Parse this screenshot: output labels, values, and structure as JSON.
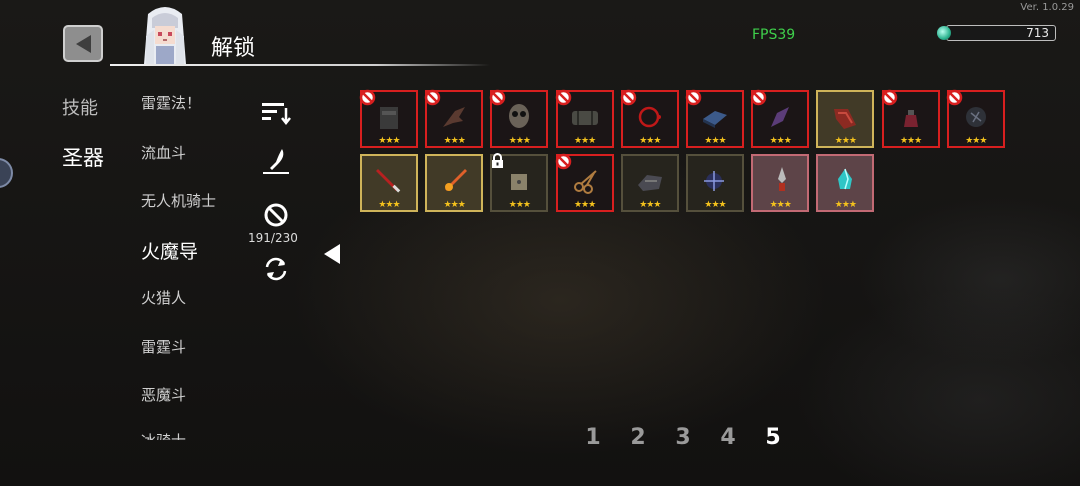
{
  "version": "Ver. 1.0.29",
  "fps": "FPS39",
  "gems": "713",
  "title": "解锁",
  "categories": [
    {
      "label": "技能",
      "active": false
    },
    {
      "label": "圣器",
      "active": true
    }
  ],
  "characters": [
    "雷霆法！",
    "流血斗",
    "无人机骑士",
    "火魔导",
    "火猎人",
    "雷霆斗",
    "恶魔斗",
    "冰骑士"
  ],
  "active_character": "火魔导",
  "tools": [
    "sort-icon",
    "quill-icon",
    "ban-icon",
    "refresh-icon"
  ],
  "unlock_count": "191/230",
  "slots": [
    {
      "item": "black-armor-icon",
      "frame": "red",
      "banned": true,
      "locked": false,
      "stars": "★★★"
    },
    {
      "item": "dark-claw-icon",
      "frame": "red",
      "banned": true,
      "locked": false,
      "stars": "★★★"
    },
    {
      "item": "skull-mask-icon",
      "frame": "red",
      "banned": true,
      "locked": false,
      "stars": "★★★"
    },
    {
      "item": "barrel-icon",
      "frame": "red",
      "banned": true,
      "locked": false,
      "stars": "★★★"
    },
    {
      "item": "red-ring-icon",
      "frame": "red",
      "banned": true,
      "locked": false,
      "stars": "★★★"
    },
    {
      "item": "blue-book-icon",
      "frame": "red",
      "banned": true,
      "locked": false,
      "stars": "★★★"
    },
    {
      "item": "purple-shard-icon",
      "frame": "red",
      "banned": true,
      "locked": false,
      "stars": "★★★"
    },
    {
      "item": "red-gauntlet-icon",
      "frame": "gold",
      "banned": false,
      "locked": false,
      "stars": "★★★"
    },
    {
      "item": "red-potion-icon",
      "frame": "red",
      "banned": true,
      "locked": false,
      "stars": "★★★"
    },
    {
      "item": "dark-orb-icon",
      "frame": "red",
      "banned": true,
      "locked": false,
      "stars": "★★★"
    },
    {
      "item": "red-sword-icon",
      "frame": "gold",
      "banned": false,
      "locked": false,
      "stars": "★★★"
    },
    {
      "item": "flame-sword-icon",
      "frame": "gold",
      "banned": false,
      "locked": false,
      "stars": "★★★"
    },
    {
      "item": "dice-icon",
      "frame": "dim",
      "banned": false,
      "locked": true,
      "stars": "★★★"
    },
    {
      "item": "scissors-icon",
      "frame": "red",
      "banned": true,
      "locked": false,
      "stars": "★★★"
    },
    {
      "item": "dark-stone-icon",
      "frame": "dim",
      "banned": false,
      "locked": false,
      "stars": "★★★"
    },
    {
      "item": "star-staff-icon",
      "frame": "dim",
      "banned": false,
      "locked": false,
      "stars": "★★★"
    },
    {
      "item": "red-dagger-icon",
      "frame": "pink",
      "banned": false,
      "locked": false,
      "stars": "★★★"
    },
    {
      "item": "cyan-crystal-icon",
      "frame": "pink",
      "banned": false,
      "locked": false,
      "stars": "★★★"
    }
  ],
  "pages": [
    "1",
    "2",
    "3",
    "4",
    "5"
  ],
  "current_page": "5",
  "colors": {
    "fps": "#3fcf4b",
    "banned_frame": "#d81f1f",
    "owned_frame": "#cfb45a",
    "star": "#f4c21d",
    "gem": "#2bb38f"
  }
}
